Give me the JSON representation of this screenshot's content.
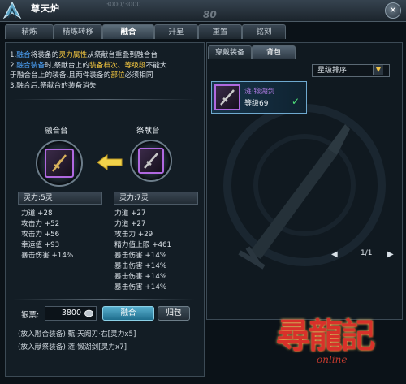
{
  "window": {
    "title": "尊天炉",
    "hp_ghost": "3000/3000",
    "level_ghost": "80",
    "close_glyph": "✕"
  },
  "tabs": [
    {
      "label": "精炼",
      "active": false
    },
    {
      "label": "精炼转移",
      "active": false
    },
    {
      "label": "融合",
      "active": true
    },
    {
      "label": "升星",
      "active": false
    },
    {
      "label": "重置",
      "active": false
    },
    {
      "label": "铭刻",
      "active": false
    }
  ],
  "rules": {
    "l1_a": "1.",
    "l1_b": "融合",
    "l1_c": "将装备的",
    "l1_d": "灵力属性",
    "l1_e": "从祭献台重叠到融合台",
    "l2_a": "2.",
    "l2_b": "融合装备",
    "l2_c": "时,祭献台上的",
    "l2_d": "装备档次、等级段",
    "l2_e": "不能大",
    "l3": "于融合台上的装备,且两件装备的",
    "l3_hl": "部位",
    "l3_end": "必须相同",
    "l4": "3.融合后,祭献台的装备消失"
  },
  "fusion_altar": {
    "title": "融合台",
    "spirit": "灵力:5灵",
    "stats": [
      "力道 +28",
      "攻击力 +52",
      "攻击力 +56",
      "幸运值 +93",
      "暴击伤害 +14%"
    ]
  },
  "sacrifice_altar": {
    "title": "祭献台",
    "spirit": "灵力:7灵",
    "stats": [
      "力道 +27",
      "力道 +27",
      "攻击力 +29",
      "精力值上限 +461",
      "暴击伤害 +14%",
      "暴击伤害 +14%",
      "暴击伤害 +14%",
      "暴击伤害 +14%"
    ]
  },
  "bottom": {
    "silver_label": "银票:",
    "silver_value": "3800",
    "fuse_button": "融合",
    "return_button": "归包",
    "log1": "(放入融合装备)  甄·天阙刃·右[灵力x5]",
    "log2": "(放入献祭装备)  涟·锻湖剑[灵力x7]"
  },
  "right": {
    "tab_equipped": "穿戴装备",
    "tab_bag": "背包",
    "sort_label": "星级排序",
    "item_name": "涟·锻湖剑",
    "item_level": "等级69",
    "page": "1/1",
    "check_glyph": "✓"
  },
  "brand": {
    "logo_text": "尋龍記",
    "logo_sub": "online"
  },
  "colors": {
    "accent_blue": "#4ea6ff",
    "accent_yellow": "#f3c640",
    "item_purple": "#b068e0",
    "check_green": "#4fe07a"
  }
}
